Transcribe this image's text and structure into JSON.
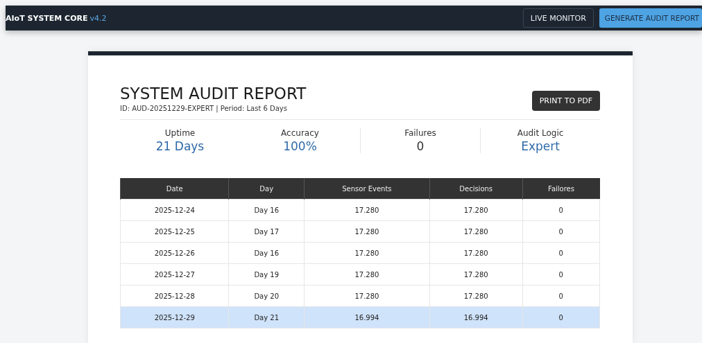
{
  "app_bar": {
    "brand": "AIoT SYSTEM CORE",
    "version": "v4.2",
    "buttons": [
      {
        "label": "LIVE MONITOR",
        "kind": "outline"
      },
      {
        "label": "GENERATE AUDIT REPORT",
        "kind": "primary"
      }
    ]
  },
  "report": {
    "title": "SYSTEM AUDIT REPORT",
    "subtitle": "ID: AUD-20251229-EXPERT | Period: Last 6 Days",
    "print_button": "PRINT TO PDF",
    "stats": [
      {
        "label": "Uptime",
        "value": "21 Days",
        "kind": "accent"
      },
      {
        "label": "Accuracy",
        "value": "100%",
        "kind": "accent"
      },
      {
        "label": "Failures",
        "value": "0",
        "kind": "plain"
      },
      {
        "label": "Audit Logic",
        "value": "Expert",
        "kind": "accent"
      }
    ],
    "table": {
      "columns": [
        "Date",
        "Day",
        "Sensor Events",
        "Decisions",
        "Failores"
      ],
      "rows": [
        {
          "cells": [
            "2025-12-24",
            "Day 16",
            "17.280",
            "17.280",
            "0"
          ],
          "selected": false
        },
        {
          "cells": [
            "2025-12-25",
            "Day 17",
            "17.280",
            "17.280",
            "0"
          ],
          "selected": false
        },
        {
          "cells": [
            "2025-12-26",
            "Day 16",
            "17.280",
            "17.280",
            "0"
          ],
          "selected": false
        },
        {
          "cells": [
            "2025-12-27",
            "Day 19",
            "17.280",
            "17.280",
            "0"
          ],
          "selected": false
        },
        {
          "cells": [
            "2025-12-28",
            "Day 20",
            "17.280",
            "17.280",
            "0"
          ],
          "selected": false
        },
        {
          "cells": [
            "2025-12-29",
            "Day 21",
            "16.994",
            "16.994",
            "0"
          ],
          "selected": true
        }
      ]
    }
  }
}
